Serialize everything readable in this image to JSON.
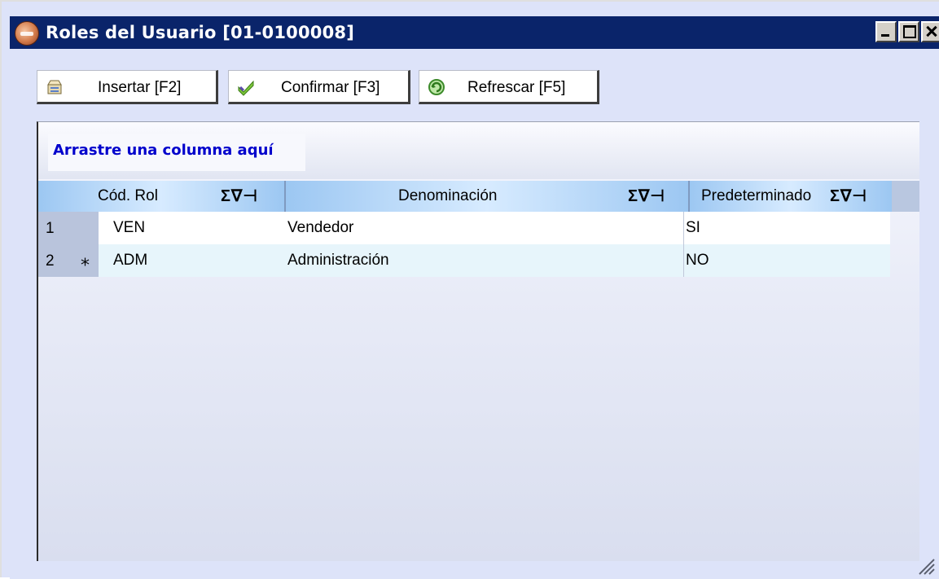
{
  "window": {
    "title": "Roles del Usuario [01-0100008]"
  },
  "toolbar": {
    "insert_label": "Insertar [F2]",
    "confirm_label": "Confirmar [F3]",
    "refresh_label": "Refrescar [F5]"
  },
  "grid": {
    "group_panel_text": "Arrastre una columna aquí",
    "columns": [
      {
        "label": "Cód. Rol",
        "icons": "Σ∇⊣"
      },
      {
        "label": "Denominación",
        "icons": "Σ∇⊣"
      },
      {
        "label": "Predeterminado",
        "icons": "Σ∇⊣"
      }
    ],
    "rows": [
      {
        "num": "1",
        "cod": "VEN",
        "den": "Vendedor",
        "pre": "SI"
      },
      {
        "num": "2",
        "cod": "ADM",
        "den": "Administración",
        "pre": "NO"
      }
    ]
  },
  "colors": {
    "titlebar": "#0a246a",
    "window_bg": "#dde3f9",
    "group_text": "#0000cc",
    "header_gradient": "#9cc7f2",
    "selected_row": "#e7f5fb"
  },
  "icons": {
    "app": "app-logo-icon",
    "insert": "insert-record-icon",
    "confirm": "checkmark-icon",
    "refresh": "refresh-icon",
    "lookup": "magnifier-lookup-icon",
    "new_row": "new-row-asterisk-icon"
  }
}
